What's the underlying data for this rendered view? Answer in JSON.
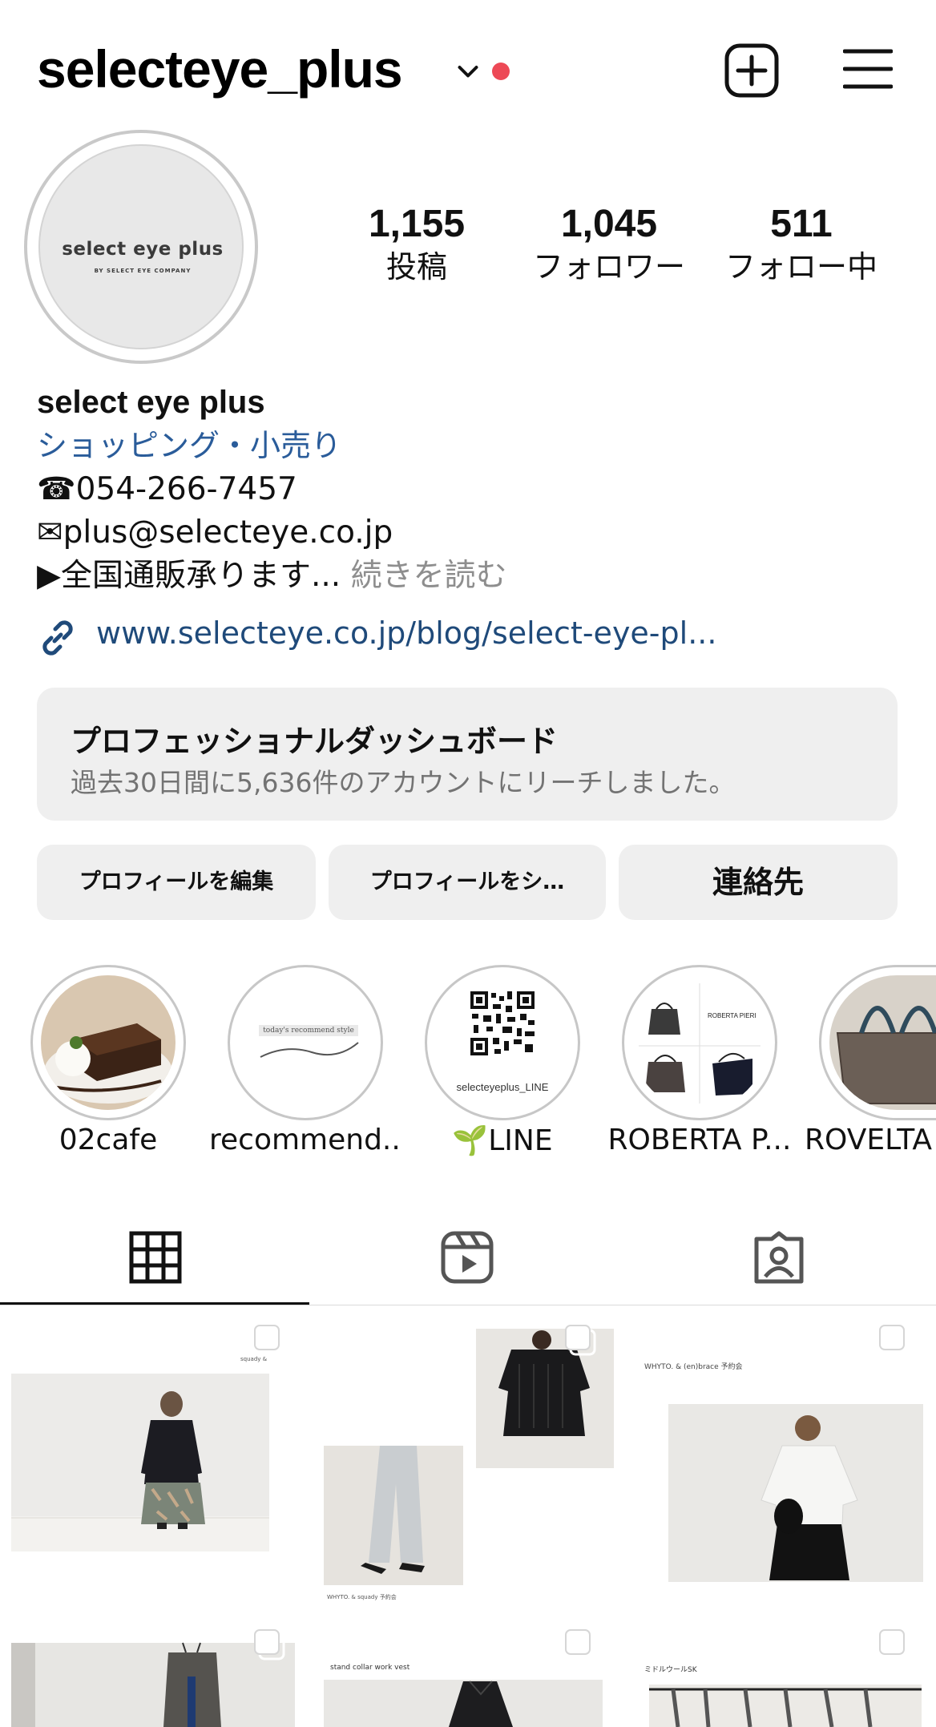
{
  "header": {
    "username": "selecteye_plus",
    "notification_color": "#ed4956"
  },
  "profile": {
    "avatar_title": "select eye plus",
    "avatar_subtitle": "BY SELECT EYE COMPANY"
  },
  "stats": [
    {
      "value": "1,155",
      "label": "投稿"
    },
    {
      "value": "1,045",
      "label": "フォロワー"
    },
    {
      "value": "511",
      "label": "フォロー中"
    }
  ],
  "bio": {
    "name": "select eye plus",
    "category": "ショッピング・小売り",
    "phone": "☎054-266-7457",
    "email": "✉plus@selecteye.co.jp",
    "description": "▶全国通販承ります...",
    "more": "続きを読む",
    "link": "www.selecteye.co.jp/blog/select-eye-pl..."
  },
  "dashboard": {
    "title": "プロフェッショナルダッシュボード",
    "subtitle": "過去30日間に5,636件のアカウントにリーチしました。"
  },
  "buttons": {
    "edit": "プロフィールを編集",
    "share": "プロフィールをシ…",
    "contact": "連絡先"
  },
  "highlights": [
    {
      "label": "02cafe"
    },
    {
      "label": "recommend...",
      "thumb_text": "today's recommend style"
    },
    {
      "label": "🌱LINE",
      "thumb_text": "selecteyeplus_LINE"
    },
    {
      "label": "ROBERTA P...",
      "thumb_text": "ROBERTA PIERI"
    },
    {
      "label": "ROVELTA"
    }
  ],
  "tabs": [
    {
      "name": "grid",
      "icon": "grid-icon"
    },
    {
      "name": "reels",
      "icon": "reels-icon"
    },
    {
      "name": "tagged",
      "icon": "tagged-icon"
    }
  ],
  "posts": [
    {
      "caption": "squady & "
    },
    {
      "caption": "WHYTO. & squady 予約会"
    },
    {
      "caption": "WHYTO. & (en)brace 予約会"
    },
    {
      "caption": ""
    },
    {
      "caption": "stand collar work vest"
    },
    {
      "caption": "ミドルウールSK"
    }
  ]
}
